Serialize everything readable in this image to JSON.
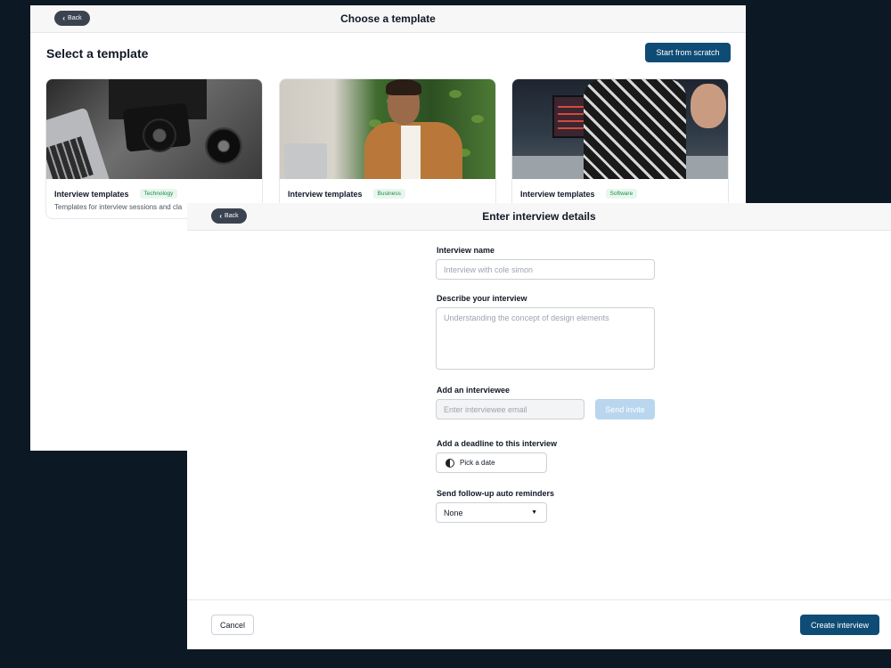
{
  "template_window": {
    "back_label": "Back",
    "title": "Choose a template",
    "heading": "Select a template",
    "scratch_button": "Start from scratch",
    "cards": [
      {
        "name": "Interview templates",
        "badge": "Technology",
        "description": "Templates for interview sessions and cla",
        "image": "camera-photo"
      },
      {
        "name": "Interview templates",
        "badge": "Business",
        "image": "businessman-laptop-photo"
      },
      {
        "name": "Interview templates",
        "badge": "Software",
        "image": "music-studio-photo"
      }
    ]
  },
  "details_window": {
    "back_label": "Back",
    "title": "Enter interview details",
    "fields": {
      "interview_name_label": "Interview name",
      "interview_name_placeholder": "Interview with cole simon",
      "describe_label": "Describe your interview",
      "describe_placeholder": "Understanding the concept of design elements",
      "interviewee_label": "Add an interviewee",
      "interviewee_placeholder": "Enter interviewee email",
      "send_invite": "Send invite",
      "deadline_label": "Add a deadline to this interview",
      "pick_date": "Pick a date",
      "reminders_label": "Send follow-up auto reminders",
      "reminders_value": "None"
    },
    "footer": {
      "cancel": "Cancel",
      "create": "Create interview"
    }
  },
  "colors": {
    "background": "#0c1823",
    "primary": "#0f4c75",
    "disabled_primary": "#b9d6ee",
    "badge_text": "#1f8a4c",
    "badge_bg": "#e8f7ee"
  }
}
